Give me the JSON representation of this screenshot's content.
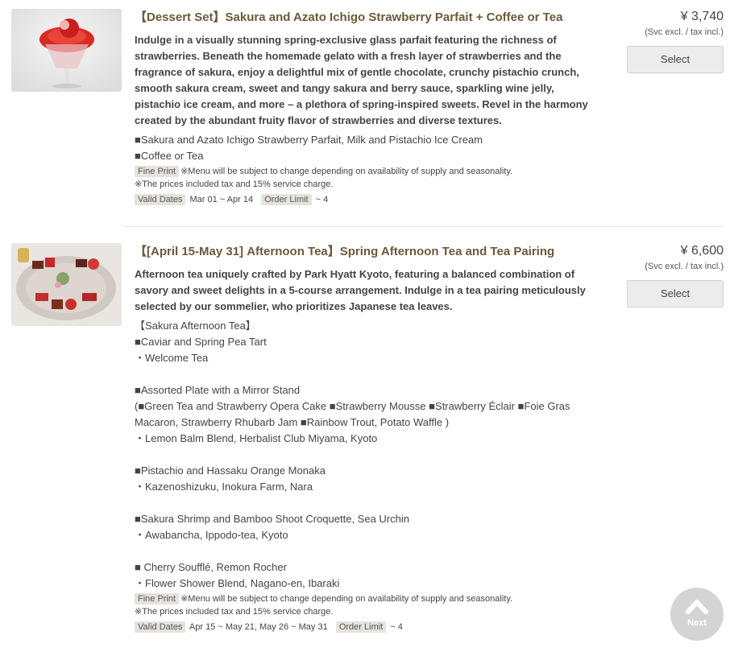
{
  "items": [
    {
      "title": "【Dessert Set】Sakura and Azato Ichigo Strawberry Parfait + Coffee or Tea",
      "description": "Indulge in a visually stunning spring-exclusive glass parfait featuring the richness of strawberries. Beneath the homemade gelato with a fresh layer of strawberries and the fragrance of sakura, enjoy a delightful mix of gentle chocolate, crunchy pistachio crunch, smooth sakura cream, sweet and tangy sakura and berry sauce, sparkling wine jelly, pistachio ice cream, and more – a plethora of spring-inspired sweets. Revel in the harmony created by the abundant fruity flavor of strawberries and diverse textures.",
      "lines": [
        "■Sakura and Azato Ichigo Strawberry Parfait, Milk and Pistachio Ice Cream",
        "■Coffee or Tea"
      ],
      "fine_print_label": "Fine Print",
      "fine_print_1": "※Menu will be subject to change depending on availability of supply and seasonality.",
      "fine_print_2": "※The prices included tax and 15% service charge.",
      "valid_dates_label": "Valid Dates",
      "valid_dates": "Mar 01 ~ Apr 14",
      "order_limit_label": "Order Limit",
      "order_limit": "~ 4",
      "price": "¥ 3,740",
      "tax_note": "(Svc excl. / tax incl.)",
      "select_label": "Select"
    },
    {
      "title": "【[April 15-May 31] Afternoon Tea】Spring Afternoon Tea and Tea Pairing",
      "description": "Afternoon tea uniquely crafted by Park Hyatt Kyoto, featuring a balanced combination of savory and sweet delights in a 5-course arrangement. Indulge in a tea pairing meticulously selected by our sommelier, who prioritizes Japanese tea leaves.",
      "lines": [
        "【Sakura Afternoon Tea】",
        "■Caviar and Spring Pea Tart",
        "・Welcome Tea",
        "",
        "■Assorted Plate with a Mirror Stand",
        "(■Green Tea and Strawberry Opera Cake ■Strawberry Mousse ■Strawberry Éclair ■Foie Gras",
        "Macaron, Strawberry Rhubarb Jam ■Rainbow Trout, Potato Waffle )",
        "・Lemon Balm Blend, Herbalist Club Miyama, Kyoto",
        "",
        "■Pistachio and Hassaku Orange Monaka",
        "・Kazenoshizuku, Inokura Farm, Nara",
        "",
        "■Sakura Shrimp and Bamboo Shoot Croquette, Sea Urchin",
        "・Awabancha, Ippodo-tea, Kyoto",
        "",
        "■ Cherry Soufflé, Remon Rocher",
        "・Flower Shower Blend, Nagano-en, Ibaraki"
      ],
      "fine_print_label": "Fine Print",
      "fine_print_1": "※Menu will be subject to change depending on availability of supply and seasonality.",
      "fine_print_2": "※The prices included tax and 15% service charge.",
      "valid_dates_label": "Valid Dates",
      "valid_dates": "Apr 15 ~ May 21, May 26 ~ May 31",
      "order_limit_label": "Order Limit",
      "order_limit": "~ 4",
      "price": "¥ 6,600",
      "tax_note": "(Svc excl. / tax incl.)",
      "select_label": "Select"
    }
  ],
  "next_button": {
    "label": "Next"
  },
  "colors": {
    "title": "#6b5a3a",
    "tag_bg": "#e6e2dc",
    "button_bg": "#ececec",
    "next_bg": "#d4d4d4"
  }
}
